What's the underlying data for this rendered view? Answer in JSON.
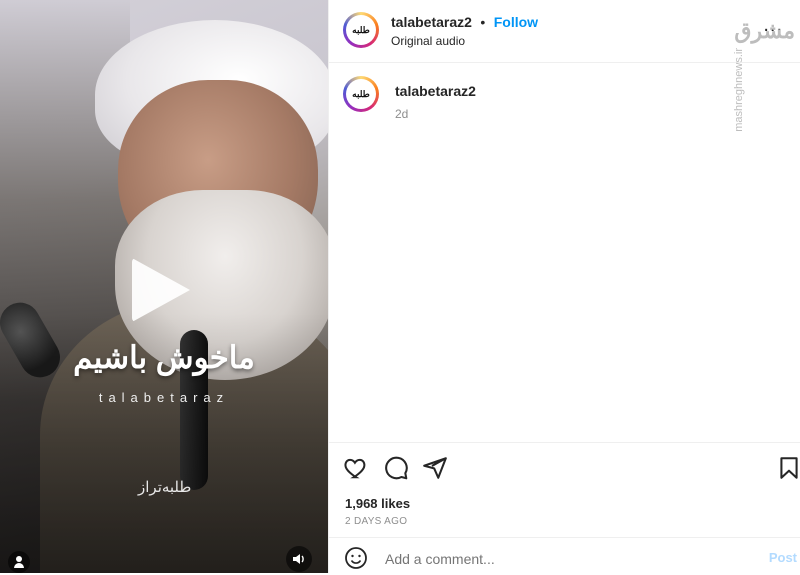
{
  "video": {
    "overlay_title": "ماخوش باشیم",
    "overlay_brand": "talabetaraz",
    "overlay_logo": "طلبه‌تراز",
    "play_icon": "play-icon",
    "user_icon": "user-icon",
    "audio_icon": "speaker-icon"
  },
  "header": {
    "avatar_text": "طلبه",
    "username": "talabetaraz2",
    "separator": "•",
    "follow_label": "Follow",
    "subtitle": "Original audio",
    "more_icon": "more-options-icon",
    "more_label": "..."
  },
  "caption": {
    "avatar_text": "طلبه",
    "username": "talabetaraz2",
    "time": "2d"
  },
  "actions": {
    "likes": "1,968 likes",
    "posted": "2 DAYS AGO"
  },
  "comment": {
    "placeholder": "Add a comment...",
    "post_label": "Post"
  },
  "watermark": {
    "logo": "مشرق",
    "url": "mashreghnews.ir"
  },
  "colors": {
    "accent": "#0095f6",
    "text": "#262626",
    "muted": "#8e8e8e"
  }
}
